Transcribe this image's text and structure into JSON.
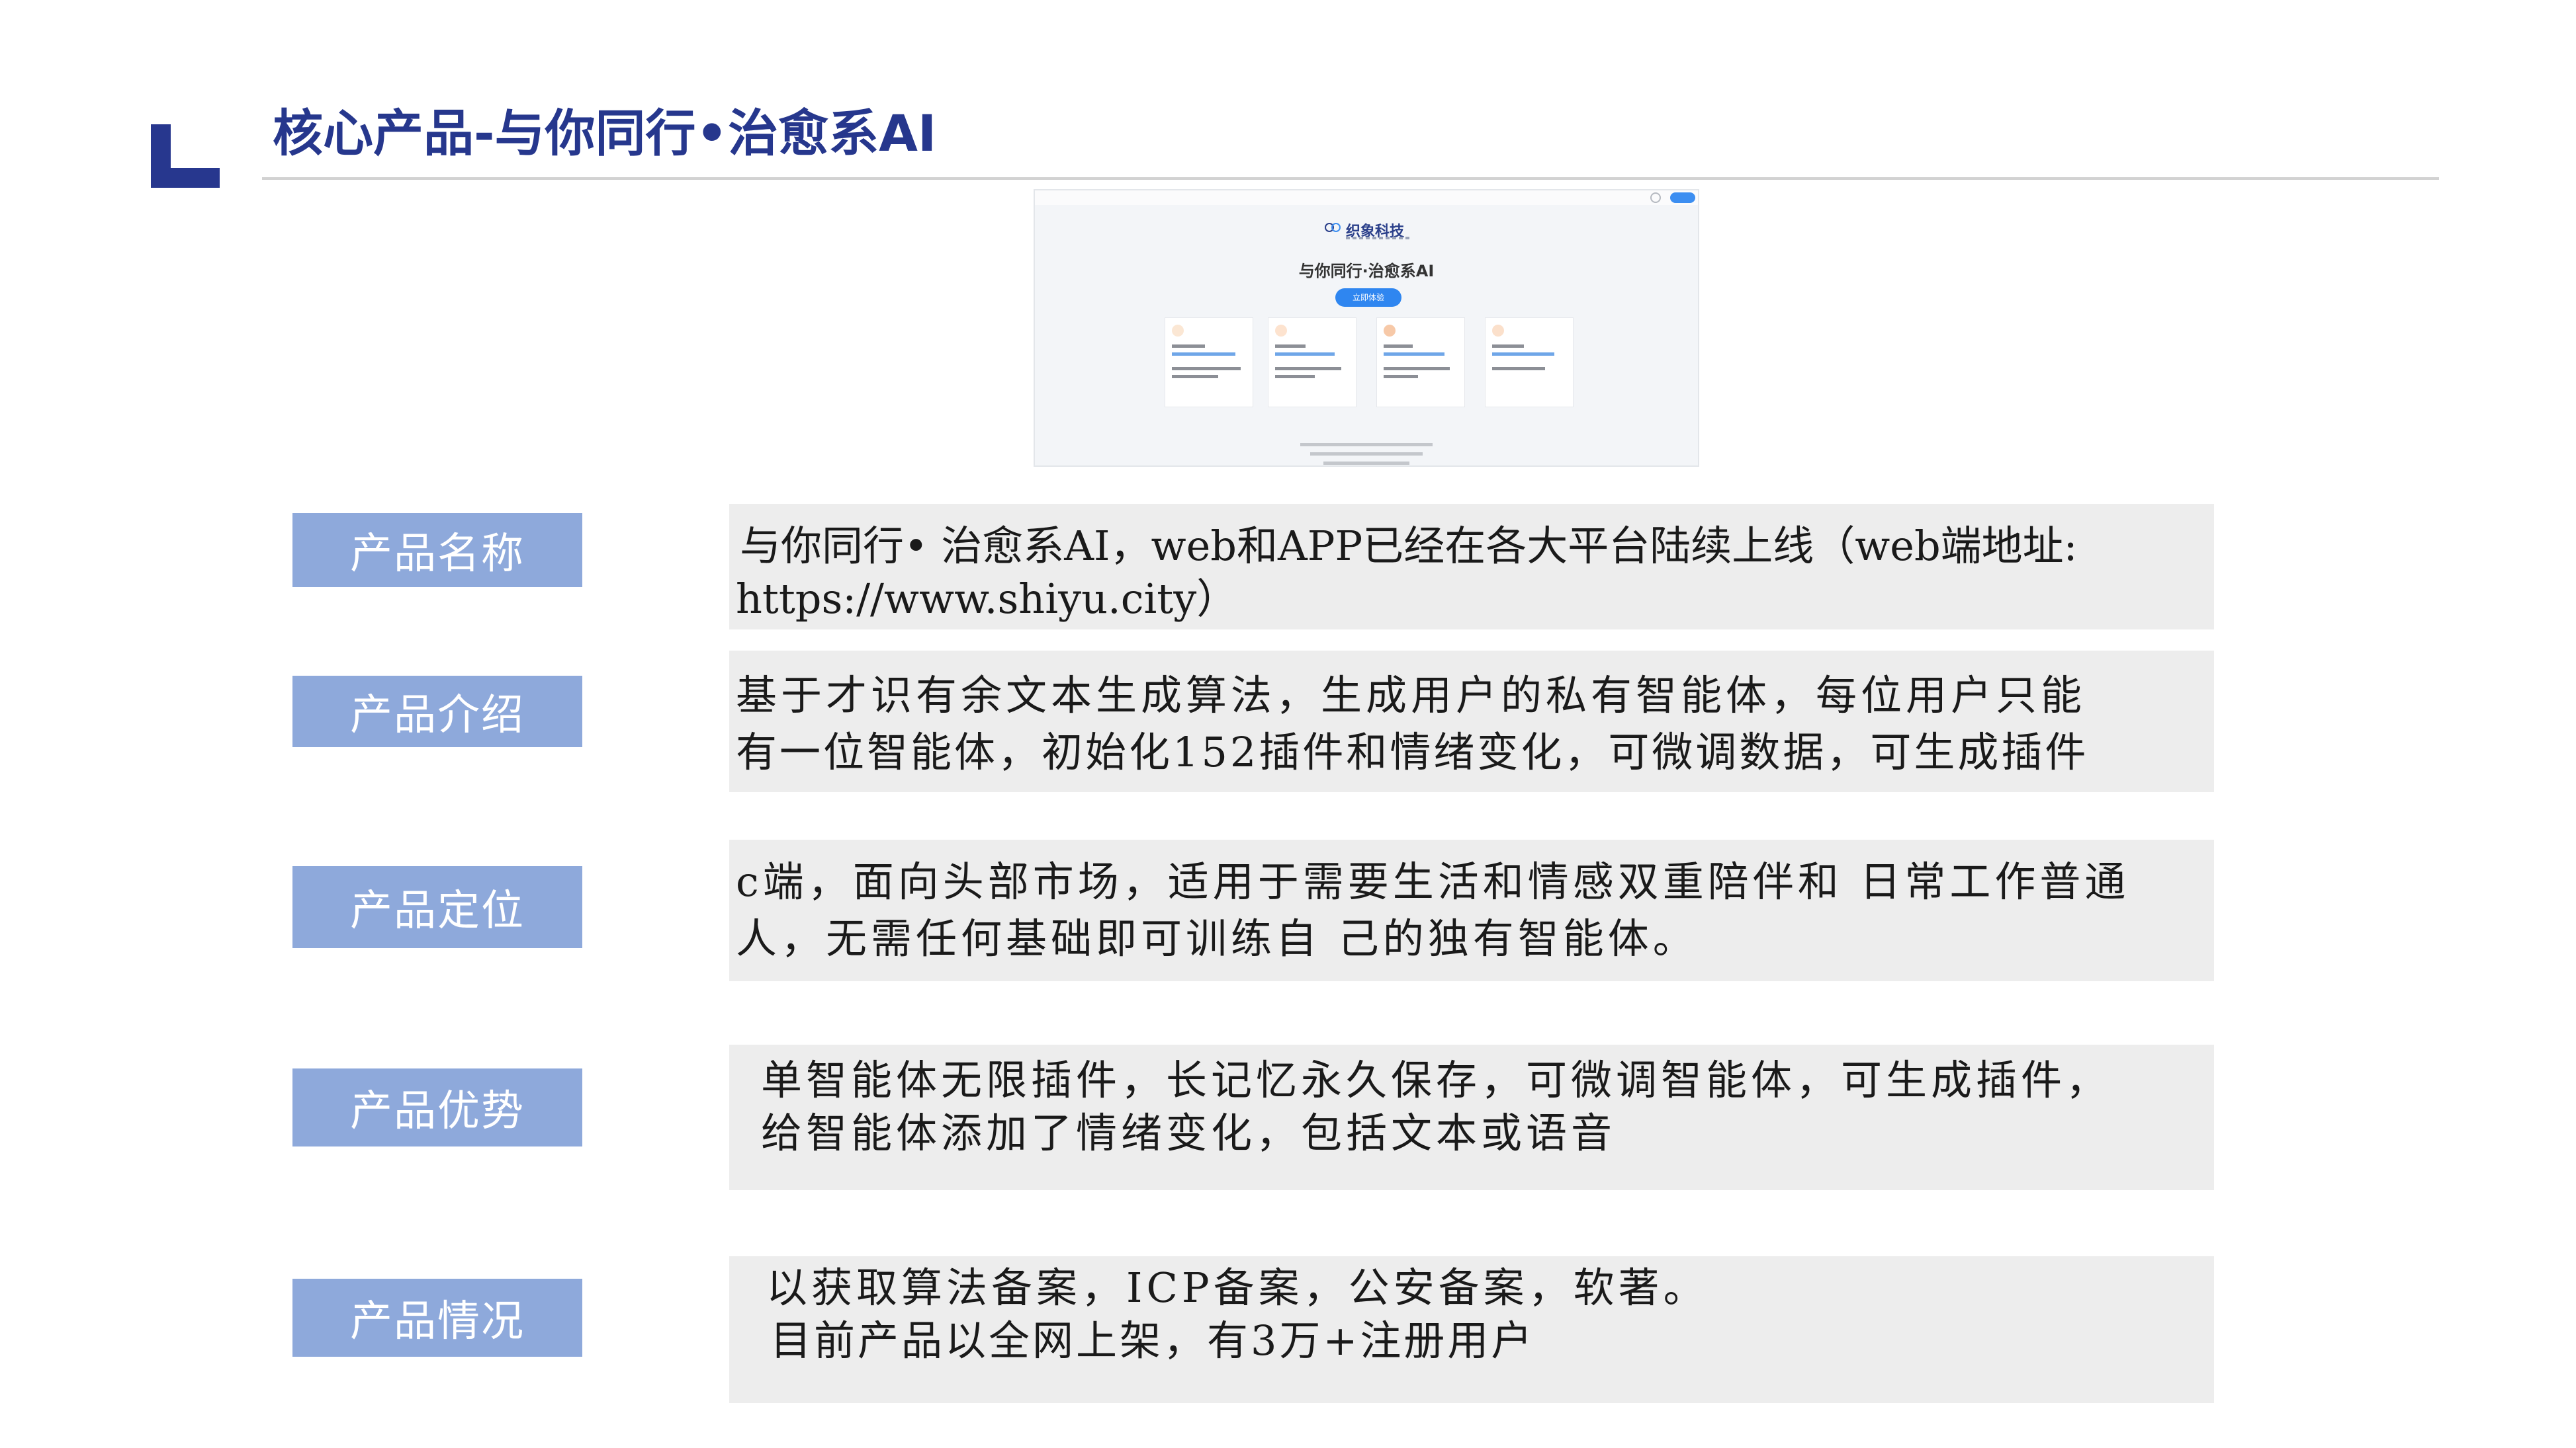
{
  "header": {
    "title": "核心产品-与你同行•治愈系AI"
  },
  "screenshot": {
    "brand": "织象科技",
    "headline": "与你同行·治愈系AI",
    "cta_label": "立即体验"
  },
  "rows": [
    {
      "label": "产品名称",
      "lines": [
        "与你同行• 治愈系AI，web和APP已经在各大平台陆续上线（web端地址:",
        "https://www.shiyu.city）"
      ]
    },
    {
      "label": "产品介绍",
      "lines": [
        "基于才识有余文本生成算法，生成用户的私有智能体，每位用户只能",
        "有一位智能体，初始化152插件和情绪变化，可微调数据，可生成插件"
      ]
    },
    {
      "label": "产品定位",
      "lines": [
        "c端，面向头部市场，适用于需要生活和情感双重陪伴和 日常工作普通",
        "人，无需任何基础即可训练自 己的独有智能体。"
      ]
    },
    {
      "label": "产品优势",
      "lines": [
        "单智能体无限插件，长记忆永久保存，可微调智能体，可生成插件，",
        "给智能体添加了情绪变化，包括文本或语音"
      ]
    },
    {
      "label": "产品情况",
      "lines": [
        "以获取算法备案，ICP备案，公安备案，软著。",
        "目前产品以全网上架，有3万+注册用户"
      ]
    }
  ]
}
